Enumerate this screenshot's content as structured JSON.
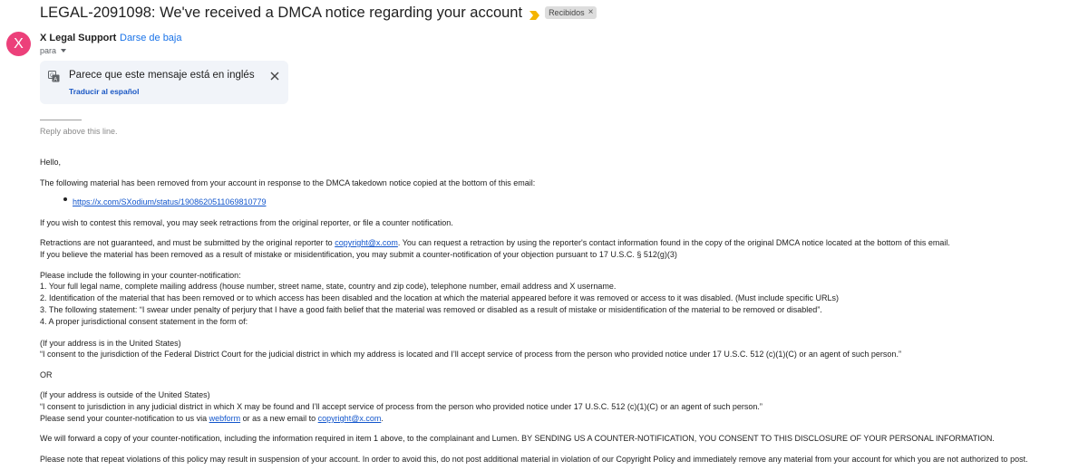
{
  "email": {
    "subject": "LEGAL-2091098: We've received a DMCA notice regarding your account",
    "label": "Recibidos",
    "sender_initial": "X",
    "sender_name": "X Legal Support",
    "unsubscribe": "Darse de baja",
    "to": "para"
  },
  "translate": {
    "message": "Parece que este mensaje está en inglés",
    "link": "Traducir al español"
  },
  "body": {
    "reply_above": "Reply above this line.",
    "greeting": "Hello,",
    "removed_intro": "The following material has been removed from your account in response to the DMCA takedown notice copied at the bottom of this email:",
    "material_link": "https://x.com/SXodium/status/1908620511069810779",
    "contest": "If you wish to contest this removal, you may seek retractions from the original reporter, or file a counter notification.",
    "retractions_pre": "Retractions are not guaranteed, and must be submitted by the original reporter to ",
    "retractions_email": "copyright@x.com",
    "retractions_post": ". You can request a retraction by using the reporter's contact information found in the copy of the original DMCA notice located at the bottom of this email.",
    "mistake": "If you believe the material has been removed as a result of mistake or misidentification, you may submit a counter-notification of your objection pursuant to 17 U.S.C. § 512(g)(3)",
    "include_intro": "Please include the following in your counter-notification:",
    "item1": "1. Your full legal name, complete mailing address (house number, street name, state, country and zip code), telephone number, email address and X username.",
    "item2": "2. Identification of the material that has been removed or to which access has been disabled and the location at which the material appeared before it was removed or access to it was disabled. (Must include specific URLs)",
    "item3": "3. The following statement: “I swear under penalty of perjury that I have a good faith belief that the material was removed or disabled as a result of mistake or misidentification of the material to be removed or disabled”.",
    "item4": "4. A proper jurisdictional consent statement in the form of:",
    "us_header": "(If your address is in the United States)",
    "us_consent": "“I consent to the jurisdiction of the Federal District Court for the judicial district in which my address is located and I’ll accept service of process from the person who provided notice under 17 U.S.C. 512 (c)(1)(C) or an agent of such person.”",
    "or": "OR",
    "outside_header": "(If your address is outside of the United States)",
    "outside_consent": "“I consent to jurisdiction in any judicial district in which X may be found and I’ll accept service of process from the person who provided notice under 17 U.S.C. 512 (c)(1)(C) or an agent of such person.”",
    "send_pre": "Please send your counter-notification to us via ",
    "send_webform": "webform",
    "send_mid": " or as a new email to ",
    "send_email": "copyright@x.com",
    "send_post": ".",
    "forward": "We will forward a copy of your counter-notification, including the information required in item 1 above, to the complainant and Lumen. BY SENDING US A COUNTER-NOTIFICATION, YOU CONSENT TO THIS DISCLOSURE OF YOUR PERSONAL INFORMATION.",
    "repeat": "Please note that repeat violations of this policy may result in suspension of your account. In order to avoid this, do not post additional material in violation of our Copyright Policy and immediately remove any material from your account for which you are not authorized to post."
  },
  "colors": {
    "avatar": "#ec407a",
    "link": "#1155cc",
    "translate_bg": "#f1f4f9",
    "importance": "#f4b400"
  },
  "icons": [
    "importance-marker-icon",
    "close-icon",
    "translate-icon",
    "chevron-down-icon"
  ]
}
